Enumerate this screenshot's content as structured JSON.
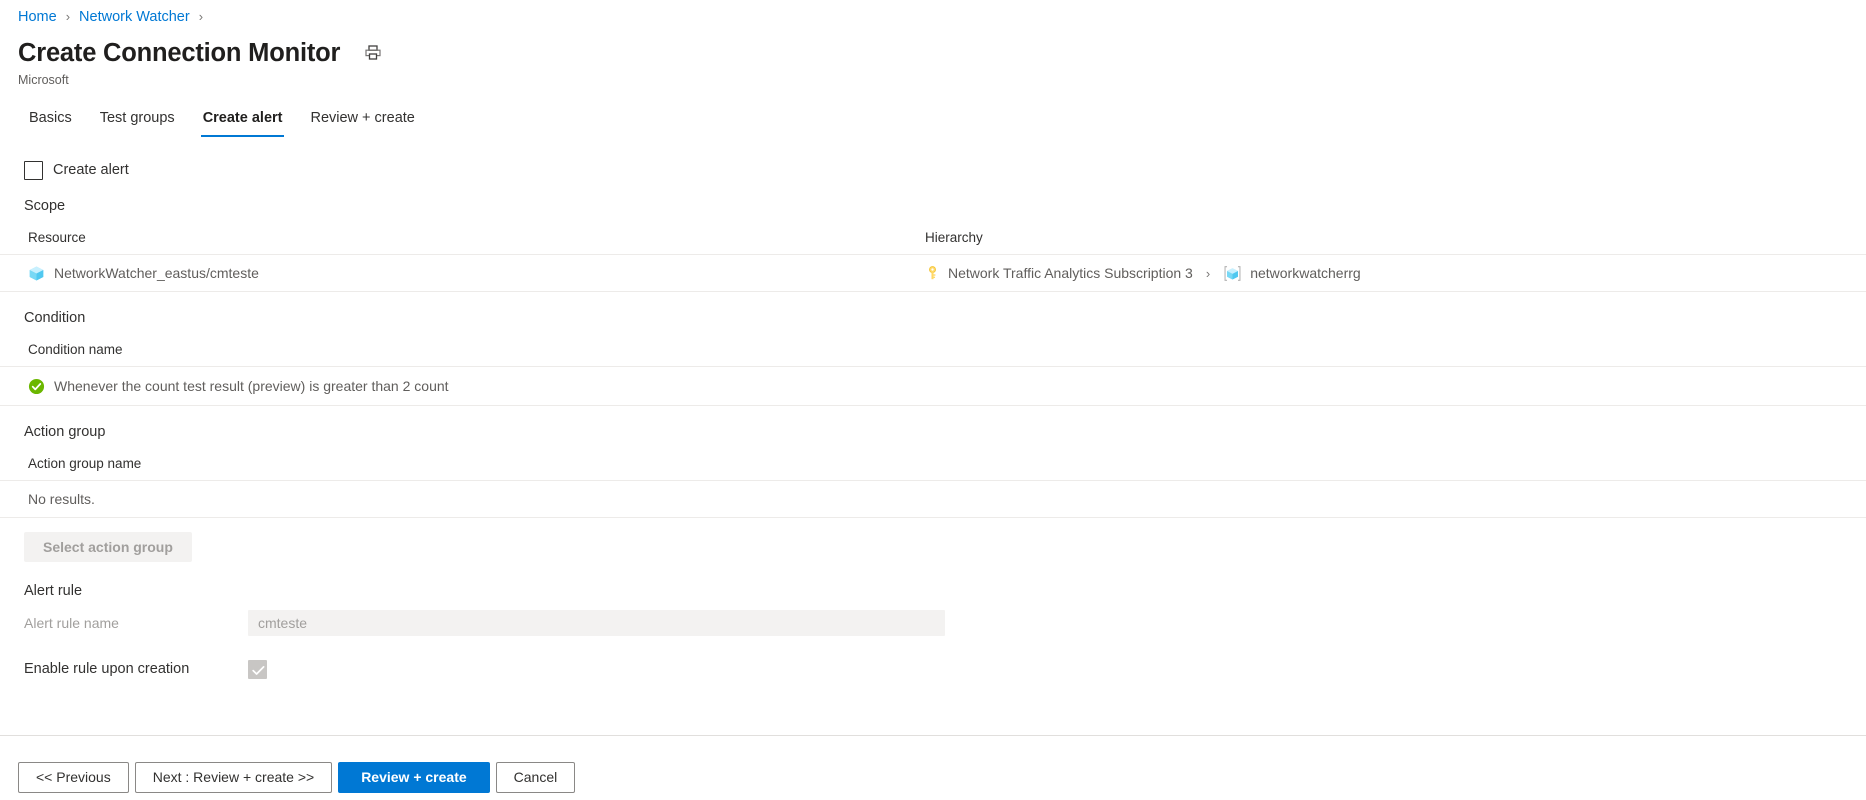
{
  "breadcrumb": {
    "items": [
      {
        "label": "Home"
      },
      {
        "label": "Network Watcher"
      }
    ],
    "separator": "›",
    "trailing_separator": "›"
  },
  "header": {
    "title": "Create Connection Monitor",
    "subtitle": "Microsoft",
    "print_icon": "print-icon"
  },
  "tabs": [
    {
      "label": "Basics",
      "active": false
    },
    {
      "label": "Test groups",
      "active": false
    },
    {
      "label": "Create alert",
      "active": true
    },
    {
      "label": "Review + create",
      "active": false
    }
  ],
  "create_alert": {
    "checkbox_label": "Create alert",
    "checked": false
  },
  "scope": {
    "section_label": "Scope",
    "columns": [
      "Resource",
      "Hierarchy"
    ],
    "rows": [
      {
        "resource_icon": "cube-icon",
        "resource": "NetworkWatcher_eastus/cmteste",
        "subscription_icon": "key-icon",
        "subscription": "Network Traffic Analytics Subscription 3",
        "hierarchy_separator": "›",
        "resource_group_icon": "resource-group-icon",
        "resource_group": "networkwatcherrg"
      }
    ]
  },
  "condition": {
    "section_label": "Condition",
    "column": "Condition name",
    "rows": [
      {
        "status_icon": "check-circle-icon",
        "text": "Whenever the count test result (preview) is greater than 2 count"
      }
    ]
  },
  "action_group": {
    "section_label": "Action group",
    "column": "Action group name",
    "empty_text": "No results.",
    "select_button": "Select action group",
    "select_button_disabled": true
  },
  "alert_rule": {
    "section_label": "Alert rule",
    "name_label": "Alert rule name",
    "name_value": "cmteste",
    "name_placeholder": "cmteste",
    "enable_label": "Enable rule upon creation",
    "enable_checked": true,
    "enable_disabled": true
  },
  "footer": {
    "buttons": [
      {
        "label": "<< Previous",
        "primary": false
      },
      {
        "label": "Next : Review + create >>",
        "primary": false
      },
      {
        "label": "Review + create",
        "primary": true
      },
      {
        "label": "Cancel",
        "primary": false
      }
    ]
  },
  "colors": {
    "accent": "#0078d4",
    "link": "#0078d4",
    "text": "#323130",
    "muted": "#605e5c",
    "disabled": "#a19f9d",
    "border": "#edebe9",
    "success": "#6bb700",
    "key": "#ffc83d",
    "cube": "#5ed0f7"
  }
}
